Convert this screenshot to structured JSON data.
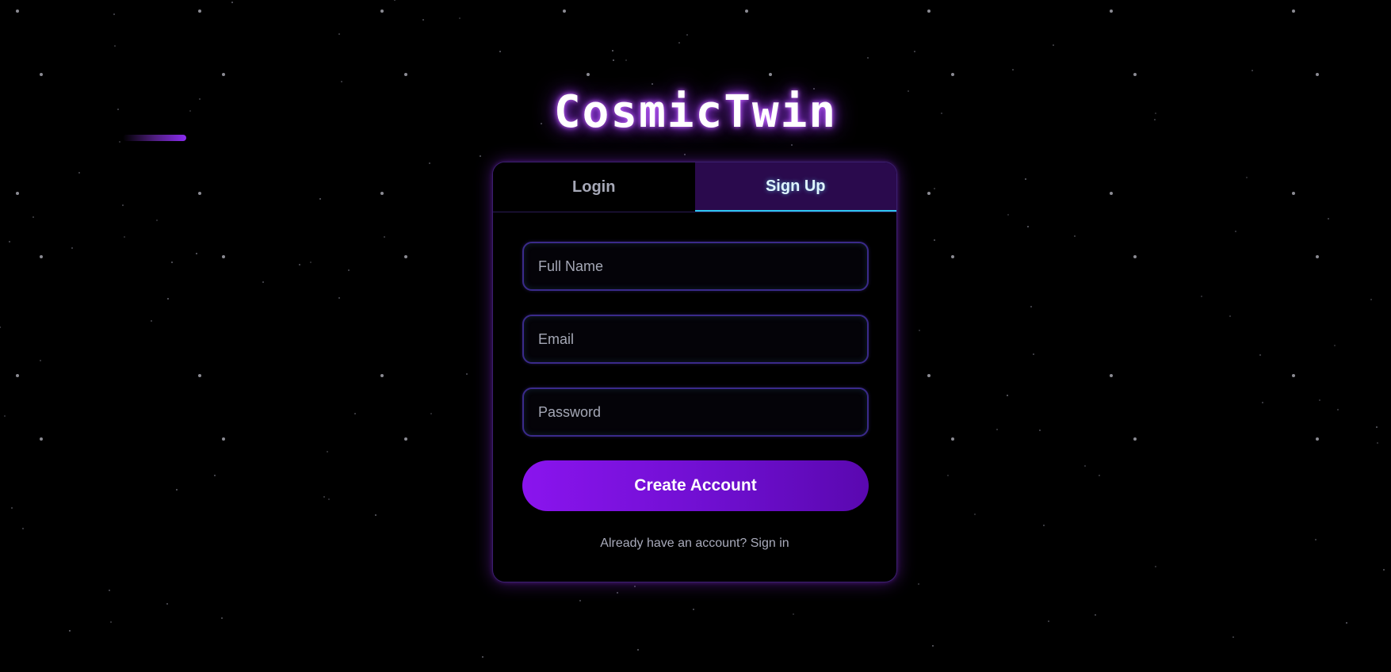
{
  "brand": {
    "title": "CosmicTwin"
  },
  "tabs": [
    {
      "label": "Login",
      "active": false
    },
    {
      "label": "Sign Up",
      "active": true
    }
  ],
  "form": {
    "full_name": {
      "placeholder": "Full Name",
      "value": ""
    },
    "email": {
      "placeholder": "Email",
      "value": ""
    },
    "password": {
      "placeholder": "Password",
      "value": ""
    },
    "submit_label": "Create Account",
    "footer_link": "Already have an account? Sign in"
  },
  "colors": {
    "background": "#000000",
    "accent_purple": "#8a14ee",
    "active_tab_bg": "#2a0a4d",
    "active_tab_underline": "#2ec6f0",
    "card_border": "#3a1f6e"
  }
}
